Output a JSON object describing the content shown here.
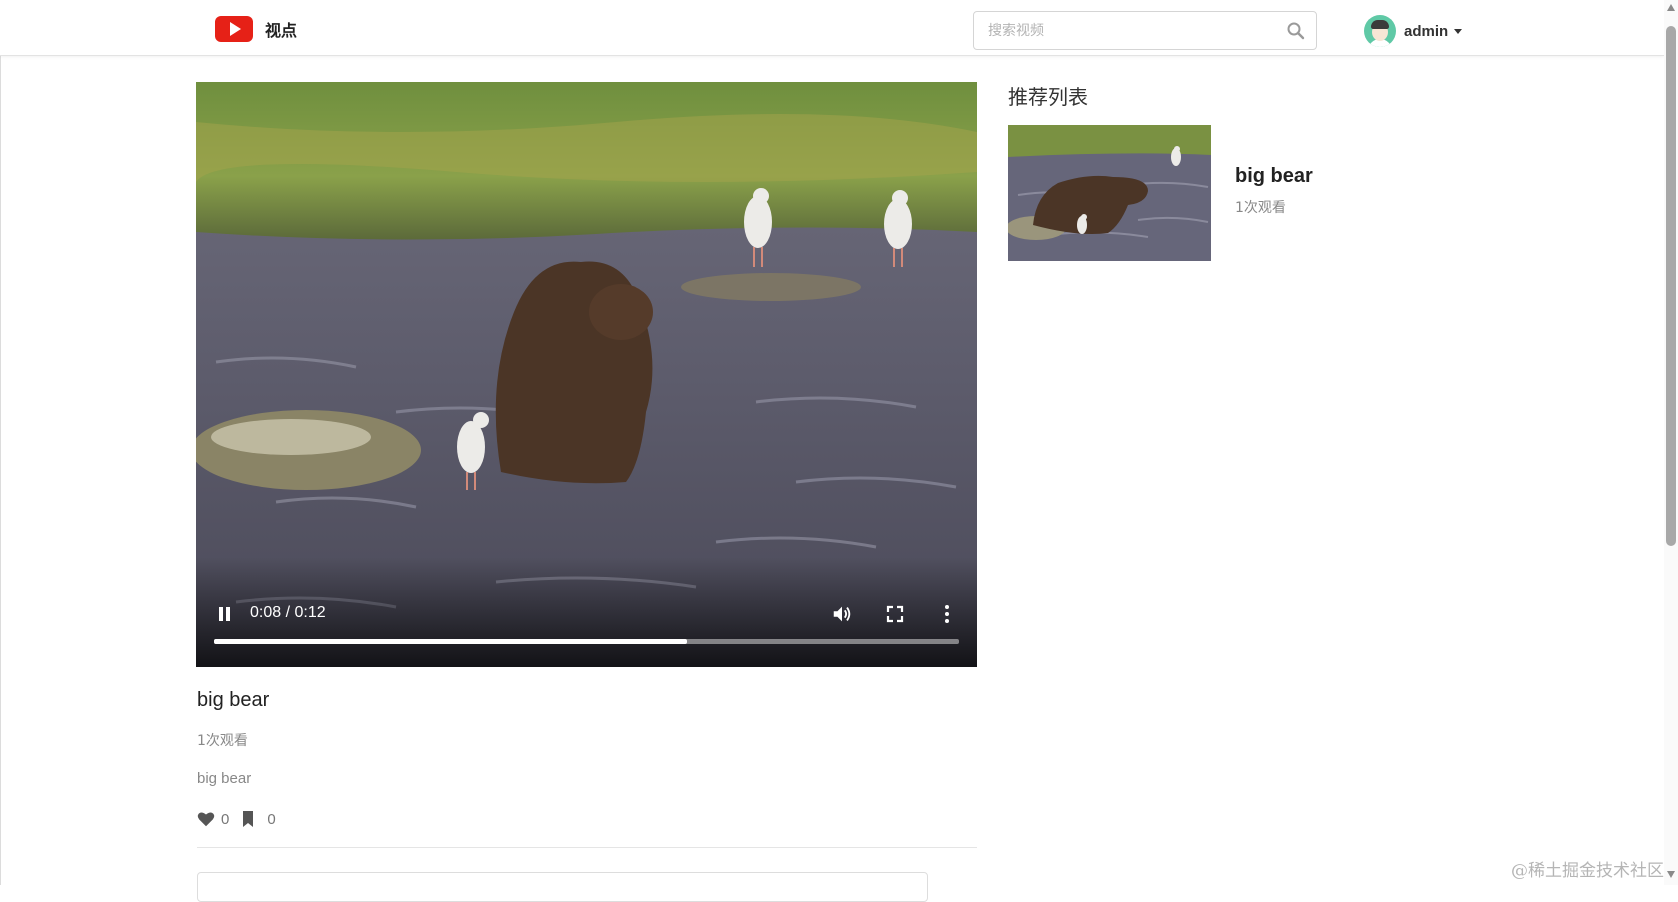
{
  "app": {
    "name": "视点"
  },
  "search": {
    "placeholder": "搜索视频",
    "value": ""
  },
  "user": {
    "name": "admin"
  },
  "video": {
    "current_time": "0:08",
    "duration": "0:12",
    "time_display": "0:08 / 0:12",
    "progress": 0.635,
    "playing": true,
    "title": "big bear",
    "views": "1次观看",
    "description": "big bear",
    "likes": "0",
    "favorites": "0"
  },
  "recommendations": {
    "heading": "推荐列表",
    "items": [
      {
        "title": "big bear",
        "views": "1次观看"
      }
    ]
  },
  "watermark": "@稀土掘金技术社区",
  "colors": {
    "brand_red": "#e62117",
    "avatar_green": "#5fc9a6",
    "text_muted": "#888888"
  },
  "icons": [
    "youtube-logo-icon",
    "search-icon",
    "caret-down-icon",
    "pause-icon",
    "volume-icon",
    "fullscreen-icon",
    "more-vert-icon",
    "heart-icon",
    "bookmark-icon"
  ]
}
